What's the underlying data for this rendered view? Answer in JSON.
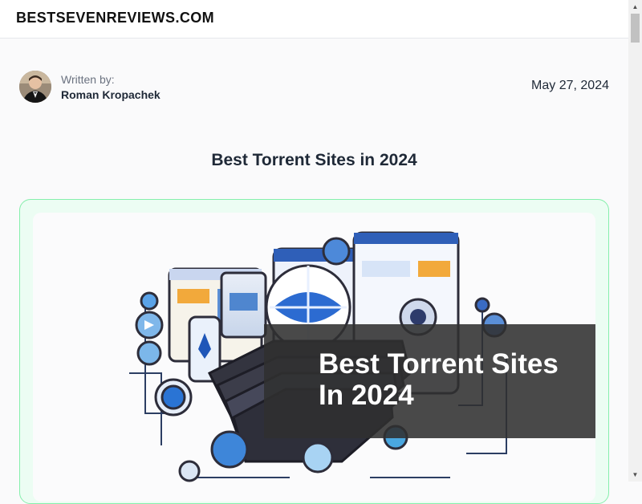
{
  "site": {
    "title": "BESTSEVENREVIEWS.COM"
  },
  "author": {
    "written_by_label": "Written by:",
    "name": "Roman Kropachek",
    "date": "May 27, 2024"
  },
  "post": {
    "title": "Best Torrent Sites in 2024",
    "hero_overlay_text": "Best Torrent Sites In 2024"
  },
  "colors": {
    "card_background": "#ecfdf3",
    "card_border": "#86efac",
    "overlay": "#303030"
  }
}
